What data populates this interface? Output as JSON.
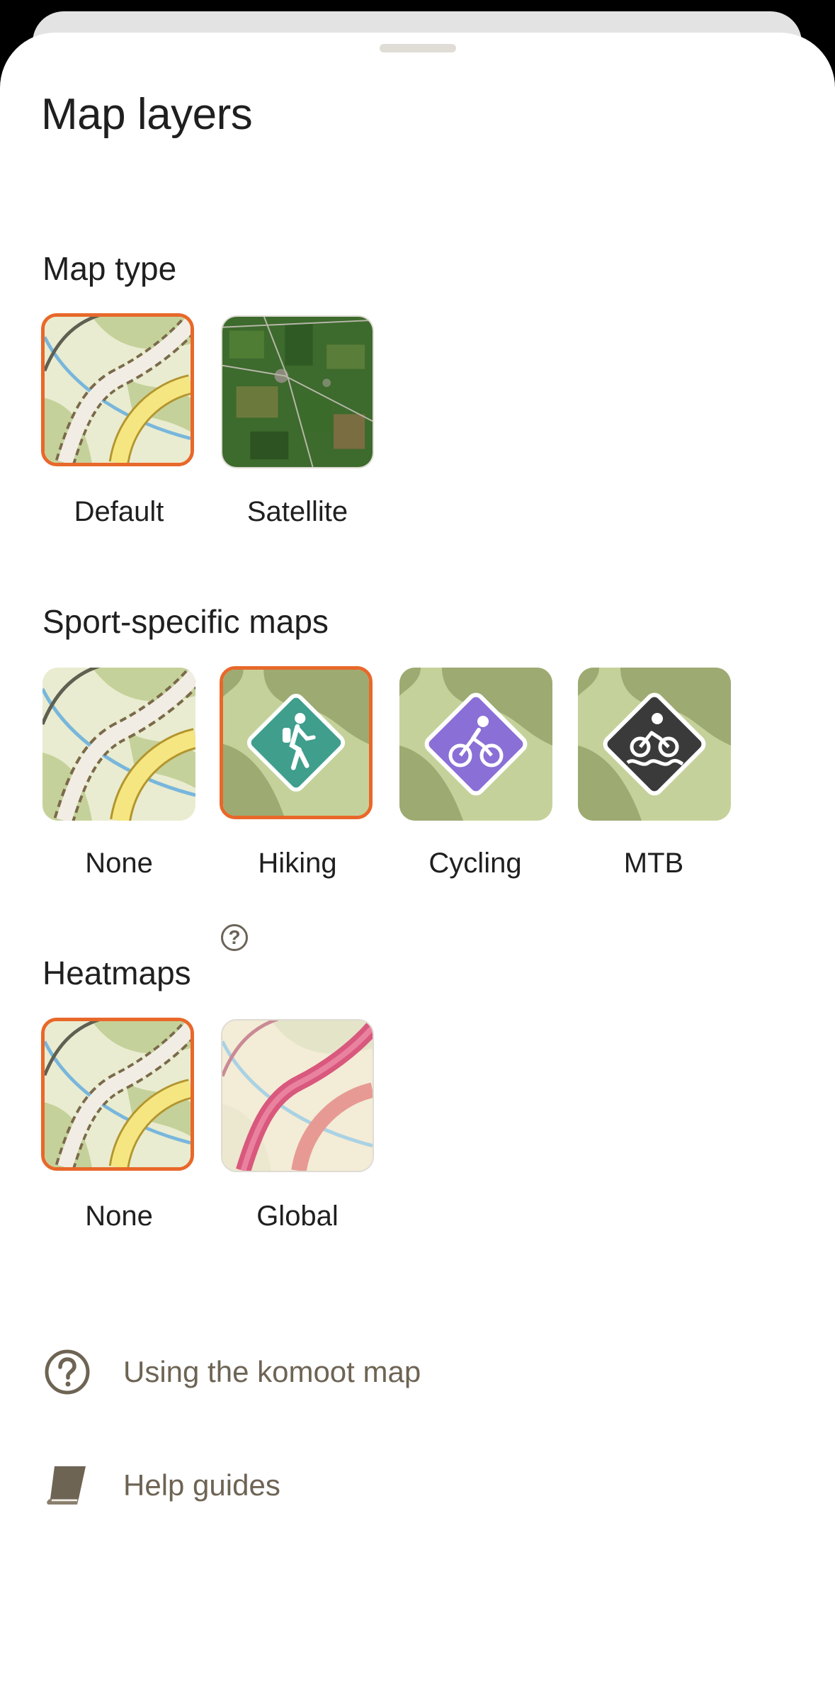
{
  "page": {
    "title": "Map layers"
  },
  "sections": {
    "map_type": {
      "title": "Map type",
      "options": [
        {
          "label": "Default",
          "selected": true
        },
        {
          "label": "Satellite",
          "selected": false
        }
      ]
    },
    "sport_maps": {
      "title": "Sport-specific maps",
      "options": [
        {
          "label": "None",
          "selected": false
        },
        {
          "label": "Hiking",
          "selected": true,
          "icon": "hiking-icon",
          "badge_color": "#3f9e8c"
        },
        {
          "label": "Cycling",
          "selected": false,
          "icon": "cycling-icon",
          "badge_color": "#8a6fd6"
        },
        {
          "label": "MTB",
          "selected": false,
          "icon": "mtb-icon",
          "badge_color": "#3a3a3a"
        }
      ]
    },
    "heatmaps": {
      "title": "Heatmaps",
      "help_icon": "question-circle-icon",
      "options": [
        {
          "label": "None",
          "selected": true
        },
        {
          "label": "Global",
          "selected": false
        }
      ]
    }
  },
  "links": [
    {
      "label": "Using the komoot map",
      "icon": "question-circle-icon"
    },
    {
      "label": "Help guides",
      "icon": "book-icon"
    }
  ],
  "colors": {
    "selected_border": "#e8682a",
    "link_text": "#6e6454",
    "map_green_light": "#c5d19a",
    "map_green_dark": "#9daa72",
    "map_cream": "#e9ecd0",
    "road_yellow": "#f6e682",
    "water_blue": "#78b6dc",
    "heat_pink": "#d9587d"
  }
}
